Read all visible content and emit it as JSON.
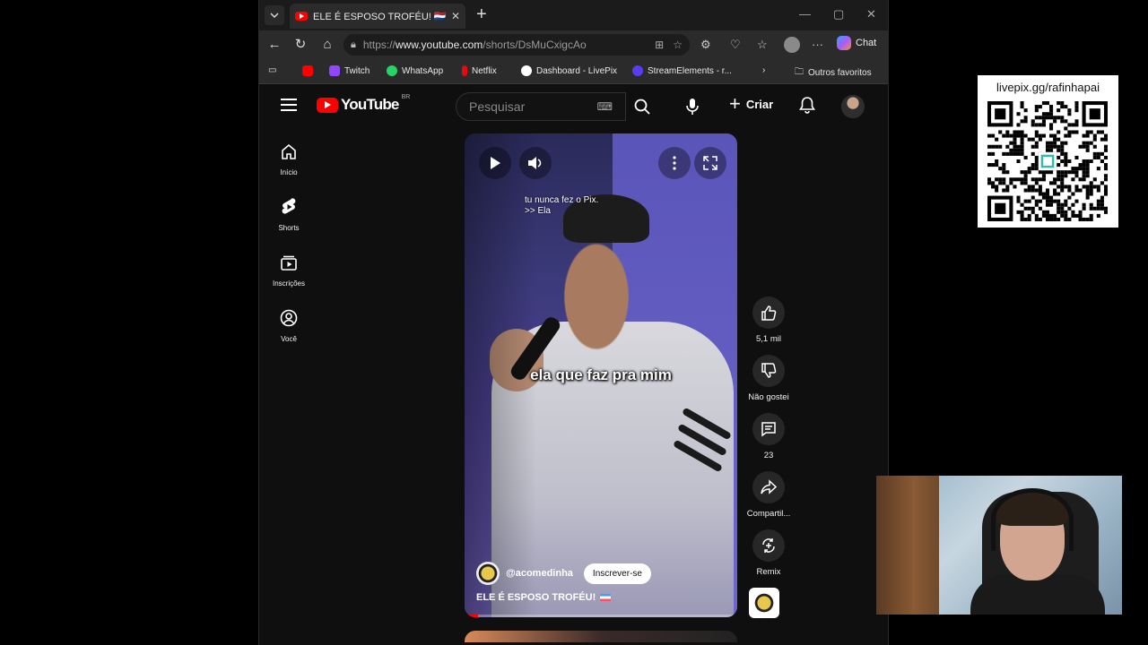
{
  "browser": {
    "tab_title": "ELE É ESPOSO TROFÉU! 🇳🇱 - YouTube",
    "url_prefix": "https://",
    "url_domain": "www.youtube.com",
    "url_path": "/shorts/DsMuCxigcAo",
    "copilot_label": "Chat",
    "favorites": [
      {
        "label": "Twitch",
        "color": "#9146ff"
      },
      {
        "label": "WhatsApp",
        "color": "#25d366"
      },
      {
        "label": "Netflix",
        "color": "#e50914"
      },
      {
        "label": "Dashboard - LivePix",
        "color": "#ffffff"
      },
      {
        "label": "StreamElements - r...",
        "color": "#5a3cf0"
      }
    ],
    "other_favorites": "Outros favoritos"
  },
  "youtube": {
    "logo_text": "YouTube",
    "region": "BR",
    "search_placeholder": "Pesquisar",
    "create_label": "Criar",
    "sidebar": [
      {
        "label": "Início",
        "icon": "home-icon"
      },
      {
        "label": "Shorts",
        "icon": "shorts-icon"
      },
      {
        "label": "Inscrições",
        "icon": "subscriptions-icon"
      },
      {
        "label": "Você",
        "icon": "you-icon"
      }
    ],
    "short": {
      "overlay_line1": "tu nunca fez o Pix.",
      "overlay_line2": ">> Ela",
      "caption": "ela que faz pra mim",
      "channel": "@acomedinha",
      "subscribe_label": "Inscrever-se",
      "title": "ELE É ESPOSO TROFÉU!",
      "progress": 0.05
    },
    "actions": {
      "like_count": "5,1 mil",
      "dislike_label": "Não gostei",
      "comments_count": "23",
      "share_label": "Compartil...",
      "remix_label": "Remix"
    }
  },
  "overlay": {
    "qr_label": "livepix.gg/rafinhapai"
  }
}
